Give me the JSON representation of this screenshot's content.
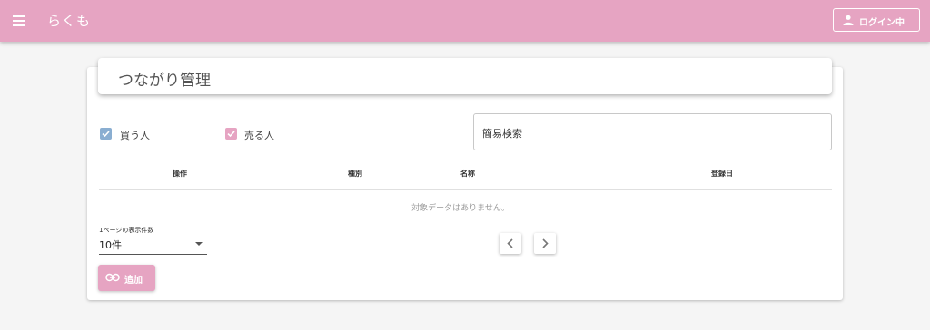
{
  "appbar": {
    "title": "らくも",
    "login_label": "ログイン中"
  },
  "page": {
    "title": "つながり管理"
  },
  "filters": {
    "buyer_label": "買う人",
    "seller_label": "売る人"
  },
  "search": {
    "placeholder": "簡易検索"
  },
  "table": {
    "headers": [
      "操作",
      "種別",
      "名称",
      "登録日"
    ],
    "empty_text": "対象データはありません。"
  },
  "pagination": {
    "per_page_label": "1ページの表示件数",
    "per_page_value": "10件"
  },
  "actions": {
    "add_label": "追加"
  },
  "colors": {
    "accent": "#e6a4c2",
    "buyer_check": "#8aaed1",
    "seller_check": "#e6a4c2"
  }
}
